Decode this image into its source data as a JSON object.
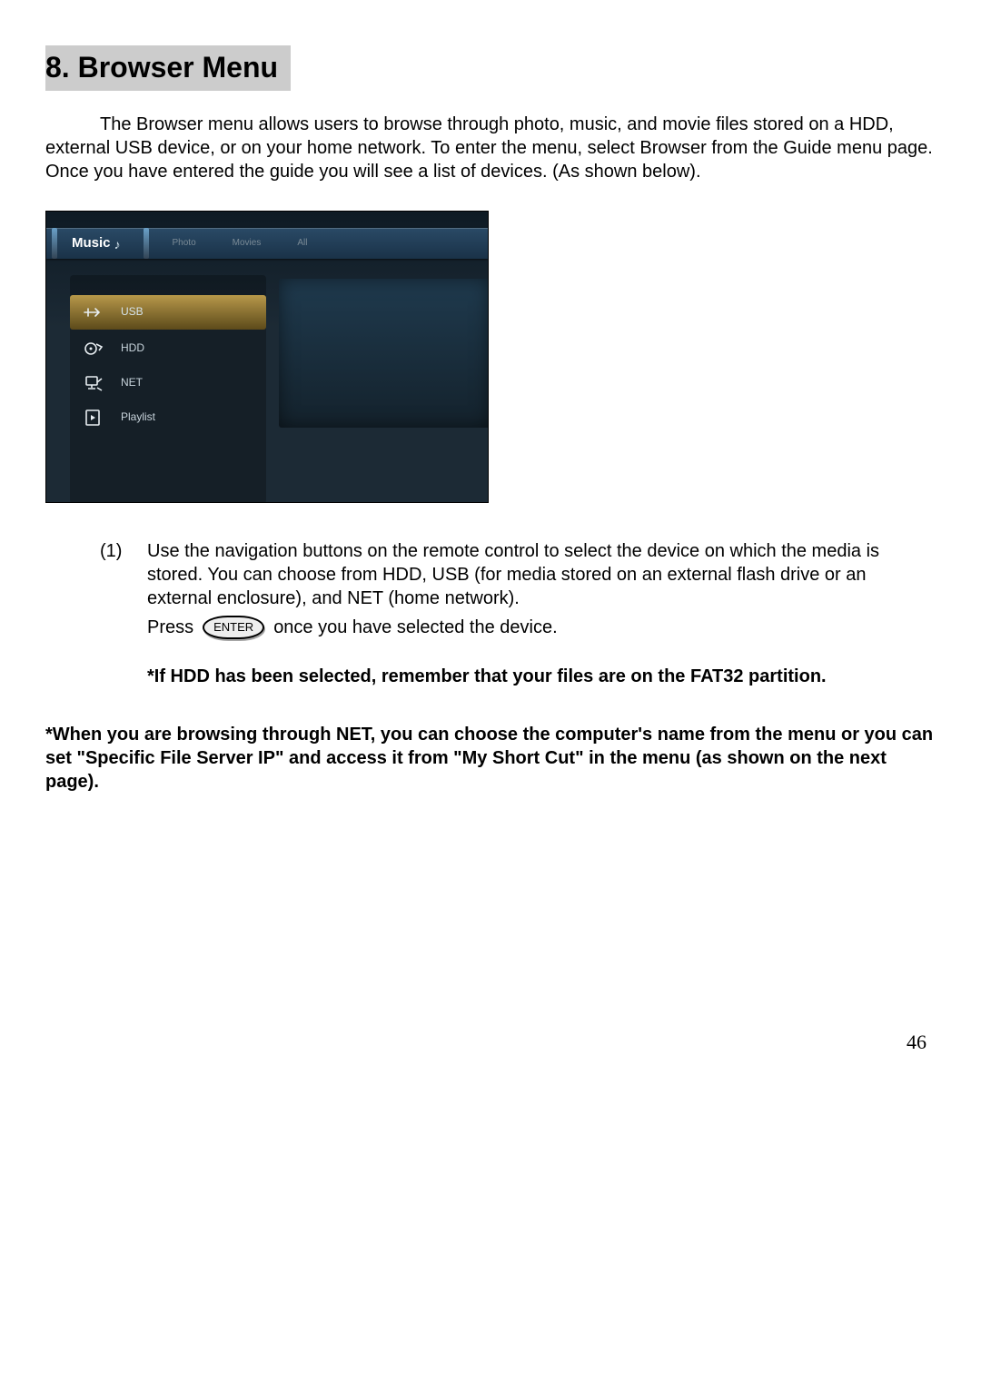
{
  "heading": "8. Browser Menu",
  "intro": "The Browser menu allows users to browse through photo, music, and movie files stored on a HDD, external USB device, or on your home network. To enter the menu, select Browser from the Guide menu page.   Once you have entered the guide you will see a list of devices. (As shown below).",
  "screenshot": {
    "tabs": {
      "active": "Music",
      "others": [
        "Photo",
        "Movies",
        "All"
      ]
    },
    "devices": [
      {
        "label": "USB",
        "selected": true
      },
      {
        "label": "HDD",
        "selected": false
      },
      {
        "label": "NET",
        "selected": false
      },
      {
        "label": "Playlist",
        "selected": false
      }
    ]
  },
  "step1_num": "(1)",
  "step1_text": "Use the navigation buttons on the remote control to select the device on which the media is stored. You can choose from HDD, USB (for media stored on an external flash drive or an external enclosure), and NET (home network).",
  "press_before": "Press",
  "enter_label": "ENTER",
  "press_after": "once you have selected the device.",
  "hdd_note": "*If HDD has been selected, remember that your files are on the FAT32 partition.",
  "net_note": "*When you are browsing through NET, you can choose the computer's name from the menu or you can set \"Specific File Server IP\" and access it from \"My Short Cut\" in the menu (as shown on the next page).",
  "page_number": "46"
}
